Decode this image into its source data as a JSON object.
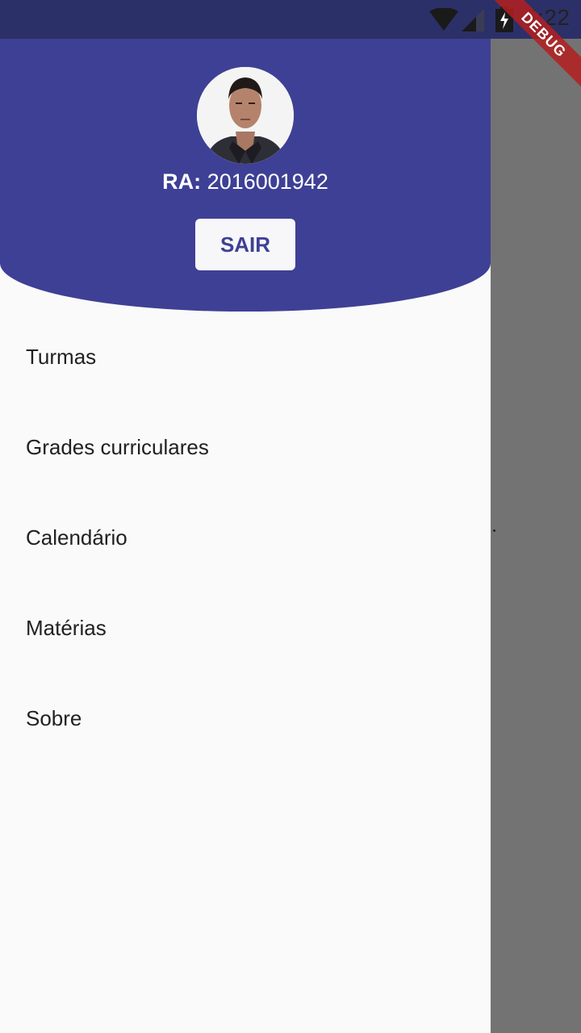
{
  "status_bar": {
    "time": "5:22",
    "icons": [
      "wifi-icon",
      "signal-icon",
      "battery-charging-icon"
    ]
  },
  "debug_banner": {
    "label": "DEBUG"
  },
  "drawer": {
    "header": {
      "ra_label": "RA:",
      "ra_value": "2016001942",
      "logout_label": "SAIR",
      "accent_color": "#3e4095"
    },
    "menu_items": [
      {
        "label": "Turmas"
      },
      {
        "label": "Grades curriculares"
      },
      {
        "label": "Calendário"
      },
      {
        "label": "Matérias"
      },
      {
        "label": "Sobre"
      }
    ]
  }
}
